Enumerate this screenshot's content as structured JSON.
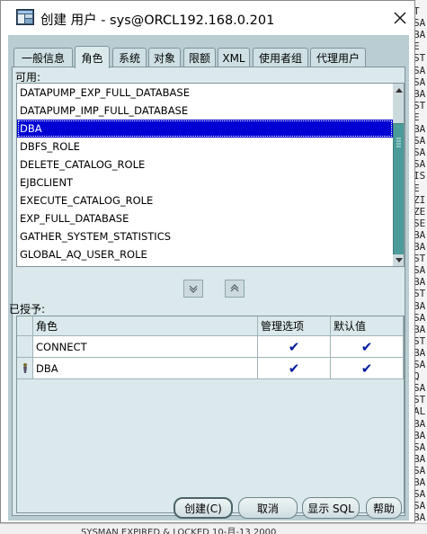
{
  "window": {
    "title": "创建 用户 - sys@ORCL192.168.0.201",
    "title_icon": "app-window-icon",
    "close_icon": "close-icon"
  },
  "tabs": [
    {
      "label": "一般信息",
      "active": false
    },
    {
      "label": "角色",
      "active": true
    },
    {
      "label": "系统",
      "active": false
    },
    {
      "label": "对象",
      "active": false
    },
    {
      "label": "限额",
      "active": false
    },
    {
      "label": "XML",
      "active": false
    },
    {
      "label": "使用者组",
      "active": false
    },
    {
      "label": "代理用户",
      "active": false
    }
  ],
  "available": {
    "label": "可用:",
    "items": [
      "DATAPUMP_EXP_FULL_DATABASE",
      "DATAPUMP_IMP_FULL_DATABASE",
      "DBA",
      "DBFS_ROLE",
      "DELETE_CATALOG_ROLE",
      "EJBCLIENT",
      "EXECUTE_CATALOG_ROLE",
      "EXP_FULL_DATABASE",
      "GATHER_SYSTEM_STATISTICS",
      "GLOBAL_AQ_USER_ROLE"
    ],
    "selected_index": 2
  },
  "move_buttons": {
    "down_icon": "chevron-down-icon",
    "up_icon": "chevron-up-icon"
  },
  "granted": {
    "label": "已授予:",
    "columns": [
      "角色",
      "管理选项",
      "默认值"
    ],
    "rows": [
      {
        "role": "CONNECT",
        "admin": true,
        "default": true,
        "current": false
      },
      {
        "role": "DBA",
        "admin": true,
        "default": true,
        "current": true
      }
    ],
    "check_glyph": "✔"
  },
  "buttons": {
    "create": "创建(C)",
    "cancel": "取消",
    "show_sql": "显示 SQL",
    "help": "帮助"
  },
  "colors": {
    "selection": "#0000d4",
    "check": "#001b9e",
    "scroll_thumb": "#4b9b9a",
    "dialog_bg": "#b9cdd2"
  },
  "background": {
    "right_column": [
      "T",
      "SA",
      "BA",
      "E",
      "ST",
      "SA",
      "SA",
      "BA",
      "ST",
      "E",
      "BA",
      "SA",
      "SA",
      "SA",
      "IS",
      "E",
      "ZI",
      "ZE",
      "SE",
      "BA",
      "BA",
      "ST",
      "SA",
      "BA",
      "ST",
      "BA",
      "SA",
      "BA",
      "ST",
      "BA",
      "SA",
      "Q",
      "SA",
      "ST",
      "AL",
      "BA",
      "BA",
      "SA",
      "BA",
      "SA",
      "BA",
      "SA",
      "SA",
      "BA"
    ],
    "bottom_text": "SYSMAN          EXPIRED & LOCKED 10-月-13   2000"
  }
}
